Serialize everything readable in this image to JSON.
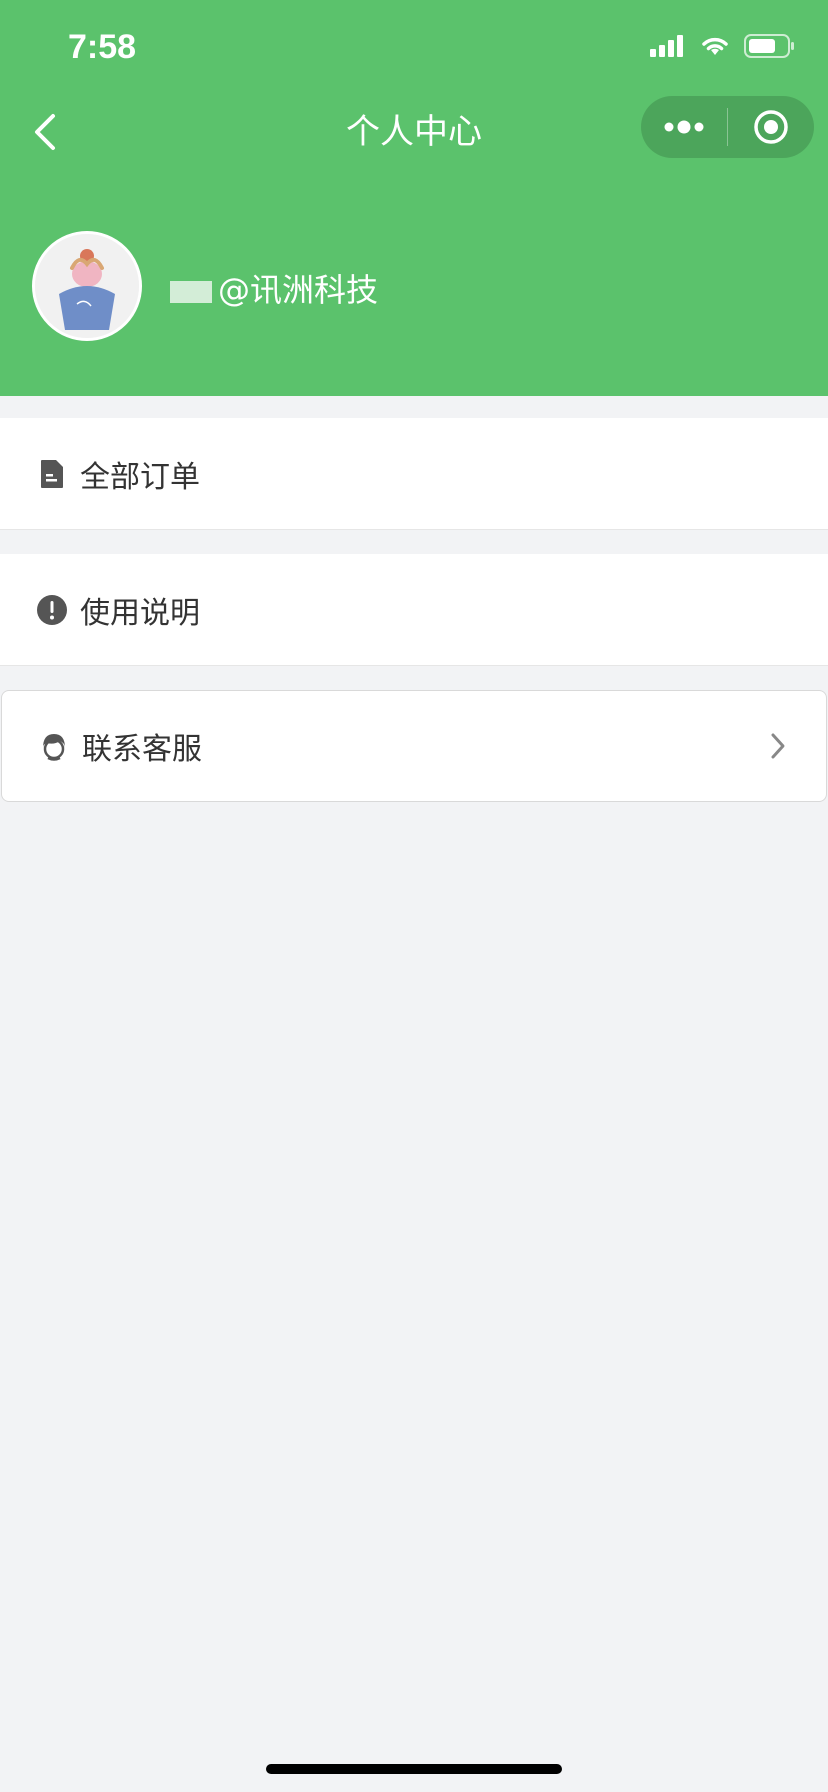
{
  "status_bar": {
    "time": "7:58",
    "signal_icon": "signal-icon",
    "wifi_icon": "wifi-icon",
    "battery_icon": "battery-icon"
  },
  "nav": {
    "title": "个人中心",
    "back_icon": "chevron-left-icon",
    "more_icon": "more-dots-icon",
    "close_icon": "target-icon"
  },
  "profile": {
    "name_prefix": "",
    "name_suffix": "@讯洲科技",
    "avatar_icon": "avatar-image"
  },
  "menu": [
    {
      "label": "全部订单",
      "icon": "document-icon"
    },
    {
      "label": "使用说明",
      "icon": "info-circle-icon"
    },
    {
      "label": "联系客服",
      "icon": "customer-service-icon",
      "chevron_icon": "chevron-right-icon"
    }
  ],
  "colors": {
    "header": "#5bc26c",
    "capsule": "#4ca55b",
    "background": "#f2f3f5",
    "text": "#333333",
    "icon": "#555555"
  }
}
